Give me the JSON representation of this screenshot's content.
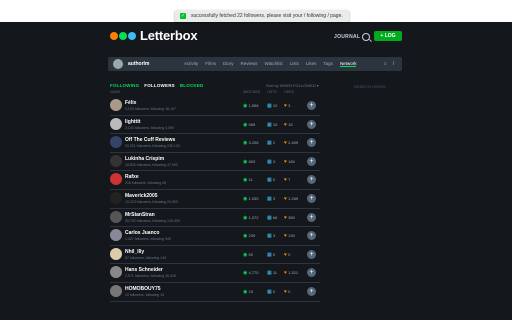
{
  "header": {
    "logo_text": "Letterbox",
    "logo_dots": [
      "#ff8000",
      "#00e054",
      "#40bcf4"
    ],
    "toast_text": "successfully fetched 22 followers. please visit your / following / page.",
    "journal_label": "JOURNAL",
    "log_button": "+ LOG",
    "search_icon": "search-icon"
  },
  "profile": {
    "username": "authorlm",
    "tabs": [
      "Activity",
      "Films",
      "Diary",
      "Reviews",
      "Watchlist",
      "Lists",
      "Likes",
      "Tags",
      "Network"
    ],
    "active_tab": "Network"
  },
  "network": {
    "subtabs": [
      "FOLLOWING",
      "FOLLOWERS",
      "BLOCKED"
    ],
    "active_subtab": "FOLLOWERS",
    "sort_label": "Sort by WHEN FOLLOWED ▾",
    "right_label": "SEARCH USERS",
    "columns": {
      "name": "NAME",
      "watched": "WATCHED",
      "lists": "LISTS",
      "likes": "LIKES"
    }
  },
  "colors": {
    "accent_green": "#00e054",
    "accent_blue": "#40bcf4",
    "accent_orange": "#ff8000",
    "background": "#14181c"
  },
  "followers": [
    {
      "name": "Félix",
      "meta": "4,100 followers, following 18,197",
      "watched": "1,598",
      "lists": "10",
      "likes": "3",
      "avatar_color": "#a98"
    },
    {
      "name": "lightttt",
      "meta": "3,103 followers, following 4,390",
      "watched": "965",
      "lists": "15",
      "likes": "15",
      "avatar_color": "#bbb"
    },
    {
      "name": "Off The Cuff Reviews",
      "meta": "20,021 followers, following 235,130",
      "watched": "3,206",
      "lists": "2",
      "likes": "2,459",
      "avatar_color": "#346"
    },
    {
      "name": "Lukinha Crispim",
      "meta": "18,502 followers, following 47,993",
      "watched": "893",
      "lists": "3",
      "likes": "184",
      "avatar_color": "#333"
    },
    {
      "name": "Rafxe",
      "meta": "216 followers, following 45",
      "watched": "11",
      "lists": "0",
      "likes": "7",
      "avatar_color": "#c33"
    },
    {
      "name": "Maverick2005",
      "meta": "10,223 followers, following 20,993",
      "watched": "1,030",
      "lists": "3",
      "likes": "1,289",
      "avatar_color": "#222"
    },
    {
      "name": "MrStanStran",
      "meta": "30,792 followers, following 129,409",
      "watched": "1,072",
      "lists": "66",
      "likes": "359",
      "avatar_color": "#555"
    },
    {
      "name": "Carlos Juanco",
      "meta": "1,427 followers, following 949",
      "watched": "239",
      "lists": "3",
      "likes": "139",
      "avatar_color": "#889"
    },
    {
      "name": "Nhil_Illy",
      "meta": "87 followers, following 149",
      "watched": "50",
      "lists": "0",
      "likes": "0",
      "avatar_color": "#dca"
    },
    {
      "name": "Hans Schneider",
      "meta": "2,571 followers, following 26,349",
      "watched": "4,770",
      "lists": "11",
      "likes": "1,321",
      "avatar_color": "#888"
    },
    {
      "name": "HOMOBOUY75",
      "meta": "10 followers, following 14",
      "watched": "15",
      "lists": "0",
      "likes": "0",
      "avatar_color": "#777"
    }
  ]
}
